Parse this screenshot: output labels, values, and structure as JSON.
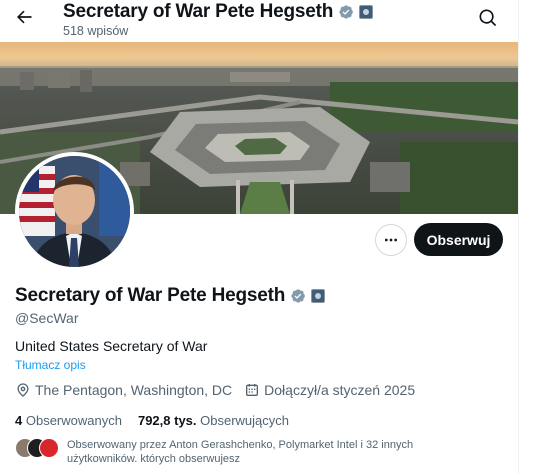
{
  "header": {
    "name": "Secretary of War Pete Hegseth",
    "post_count": "518 wpisów"
  },
  "profile": {
    "name": "Secretary of War Pete Hegseth",
    "handle": "@SecWar",
    "bio": "United States Secretary of War",
    "translate_label": "Tłumacz opis",
    "location": "The Pentagon, Washington, DC",
    "joined": "Dołączył/a styczeń 2025",
    "following_count": "4",
    "following_label": "Obserwowanych",
    "followers_count": "792,8 tys.",
    "followers_label": "Obserwujących",
    "followed_by_text": "Obserwowany przez Anton Gerashchenko, Polymarket Intel i 32 innych użytkowników. których obserwujesz",
    "follow_button_label": "Obserwuj"
  },
  "icons": {
    "back": "arrow-left-icon",
    "search": "search-icon",
    "verified": "verified-badge-icon",
    "affiliation": "government-affiliation-icon",
    "more": "more-icon",
    "location": "location-pin-icon",
    "calendar": "calendar-icon"
  },
  "colors": {
    "accent": "#1d9bf0",
    "text": "#0f1419",
    "muted": "#536471",
    "verified_gray": "#829aab",
    "follow_button": "#0f1419"
  }
}
